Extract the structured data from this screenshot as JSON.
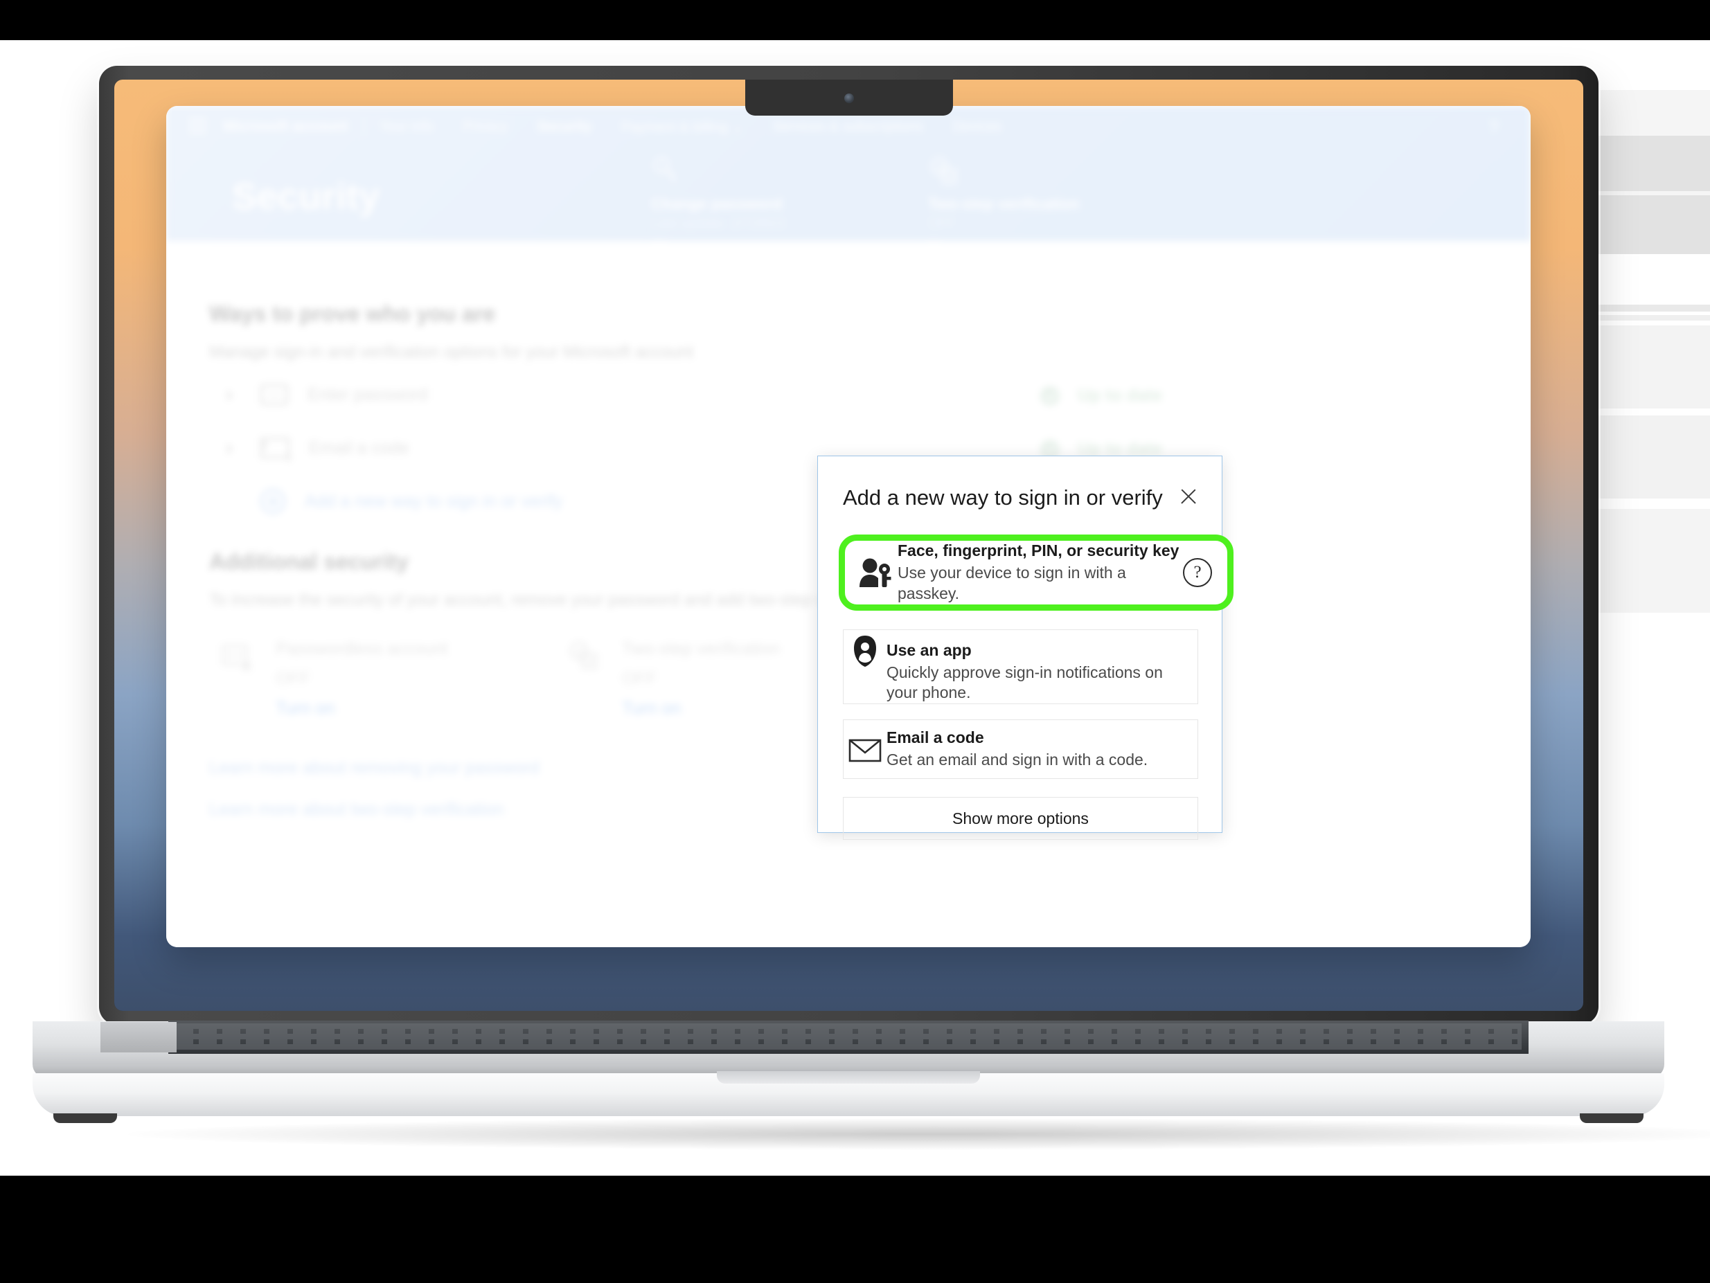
{
  "browser": {
    "nav": {
      "waffle_icon": "app-launcher-icon",
      "brand": "Microsoft account",
      "links": [
        {
          "label": "Your info",
          "active": false
        },
        {
          "label": "Privacy",
          "active": false
        },
        {
          "label": "Security",
          "active": true
        },
        {
          "label": "Payment & billing ⌄",
          "active": false
        },
        {
          "label": "Services & subscriptions",
          "active": false
        },
        {
          "label": "Devices",
          "active": false
        }
      ],
      "help_icon": "question-mark-icon",
      "help_label": "?"
    },
    "hero": {
      "title": "Security",
      "cards": [
        {
          "icon": "key-icon",
          "title": "Change password",
          "subtitle": "Last update: 2/7/2023",
          "action": "Change >"
        },
        {
          "icon": "two-step-verification-icon",
          "title": "Two-step verification",
          "subtitle": "OFF",
          "action": "Manage >"
        }
      ]
    },
    "ways_section": {
      "title": "Ways to prove who you are",
      "subtitle": "Manage sign-in and verification options for your Microsoft account",
      "rows": [
        {
          "icon": "password-dots-icon",
          "label": "Enter password",
          "status": "Up to date"
        },
        {
          "icon": "envelope-icon",
          "label": "Email a code",
          "status": "Up to date"
        }
      ],
      "add_label": "Add a new way to sign in or verify",
      "add_icon": "plus-circle-icon"
    },
    "additional_security": {
      "title": "Additional security",
      "subtitle": "To increase the security of your account, remove your password and add two-step verification.",
      "cards": [
        {
          "icon": "passwordless-icon",
          "title": "Passwordless account",
          "value": "OFF",
          "action": "Turn on"
        },
        {
          "icon": "two-step-verification-icon",
          "title": "Two-step verification",
          "value": "OFF",
          "action": "Turn on"
        }
      ],
      "links": [
        "Learn more about removing your password",
        "Learn more about two-step verification"
      ]
    }
  },
  "dialog": {
    "title": "Add a new way to sign in or verify",
    "close_icon": "close-icon",
    "highlight_color": "#4ef01e",
    "options": [
      {
        "icon": "person-key-icon",
        "title": "Face, fingerprint, PIN, or security key",
        "description": "Use your device to sign in with a passkey.",
        "help_icon": "question-circle-icon",
        "help_label": "?",
        "highlighted": true
      },
      {
        "icon": "authenticator-app-icon",
        "title": "Use an app",
        "description": "Quickly approve sign-in notifications on your phone.",
        "highlighted": false
      },
      {
        "icon": "envelope-icon",
        "title": "Email a code",
        "description": "Get an email and sign in with a code.",
        "highlighted": false
      }
    ],
    "show_more_label": "Show more options"
  }
}
